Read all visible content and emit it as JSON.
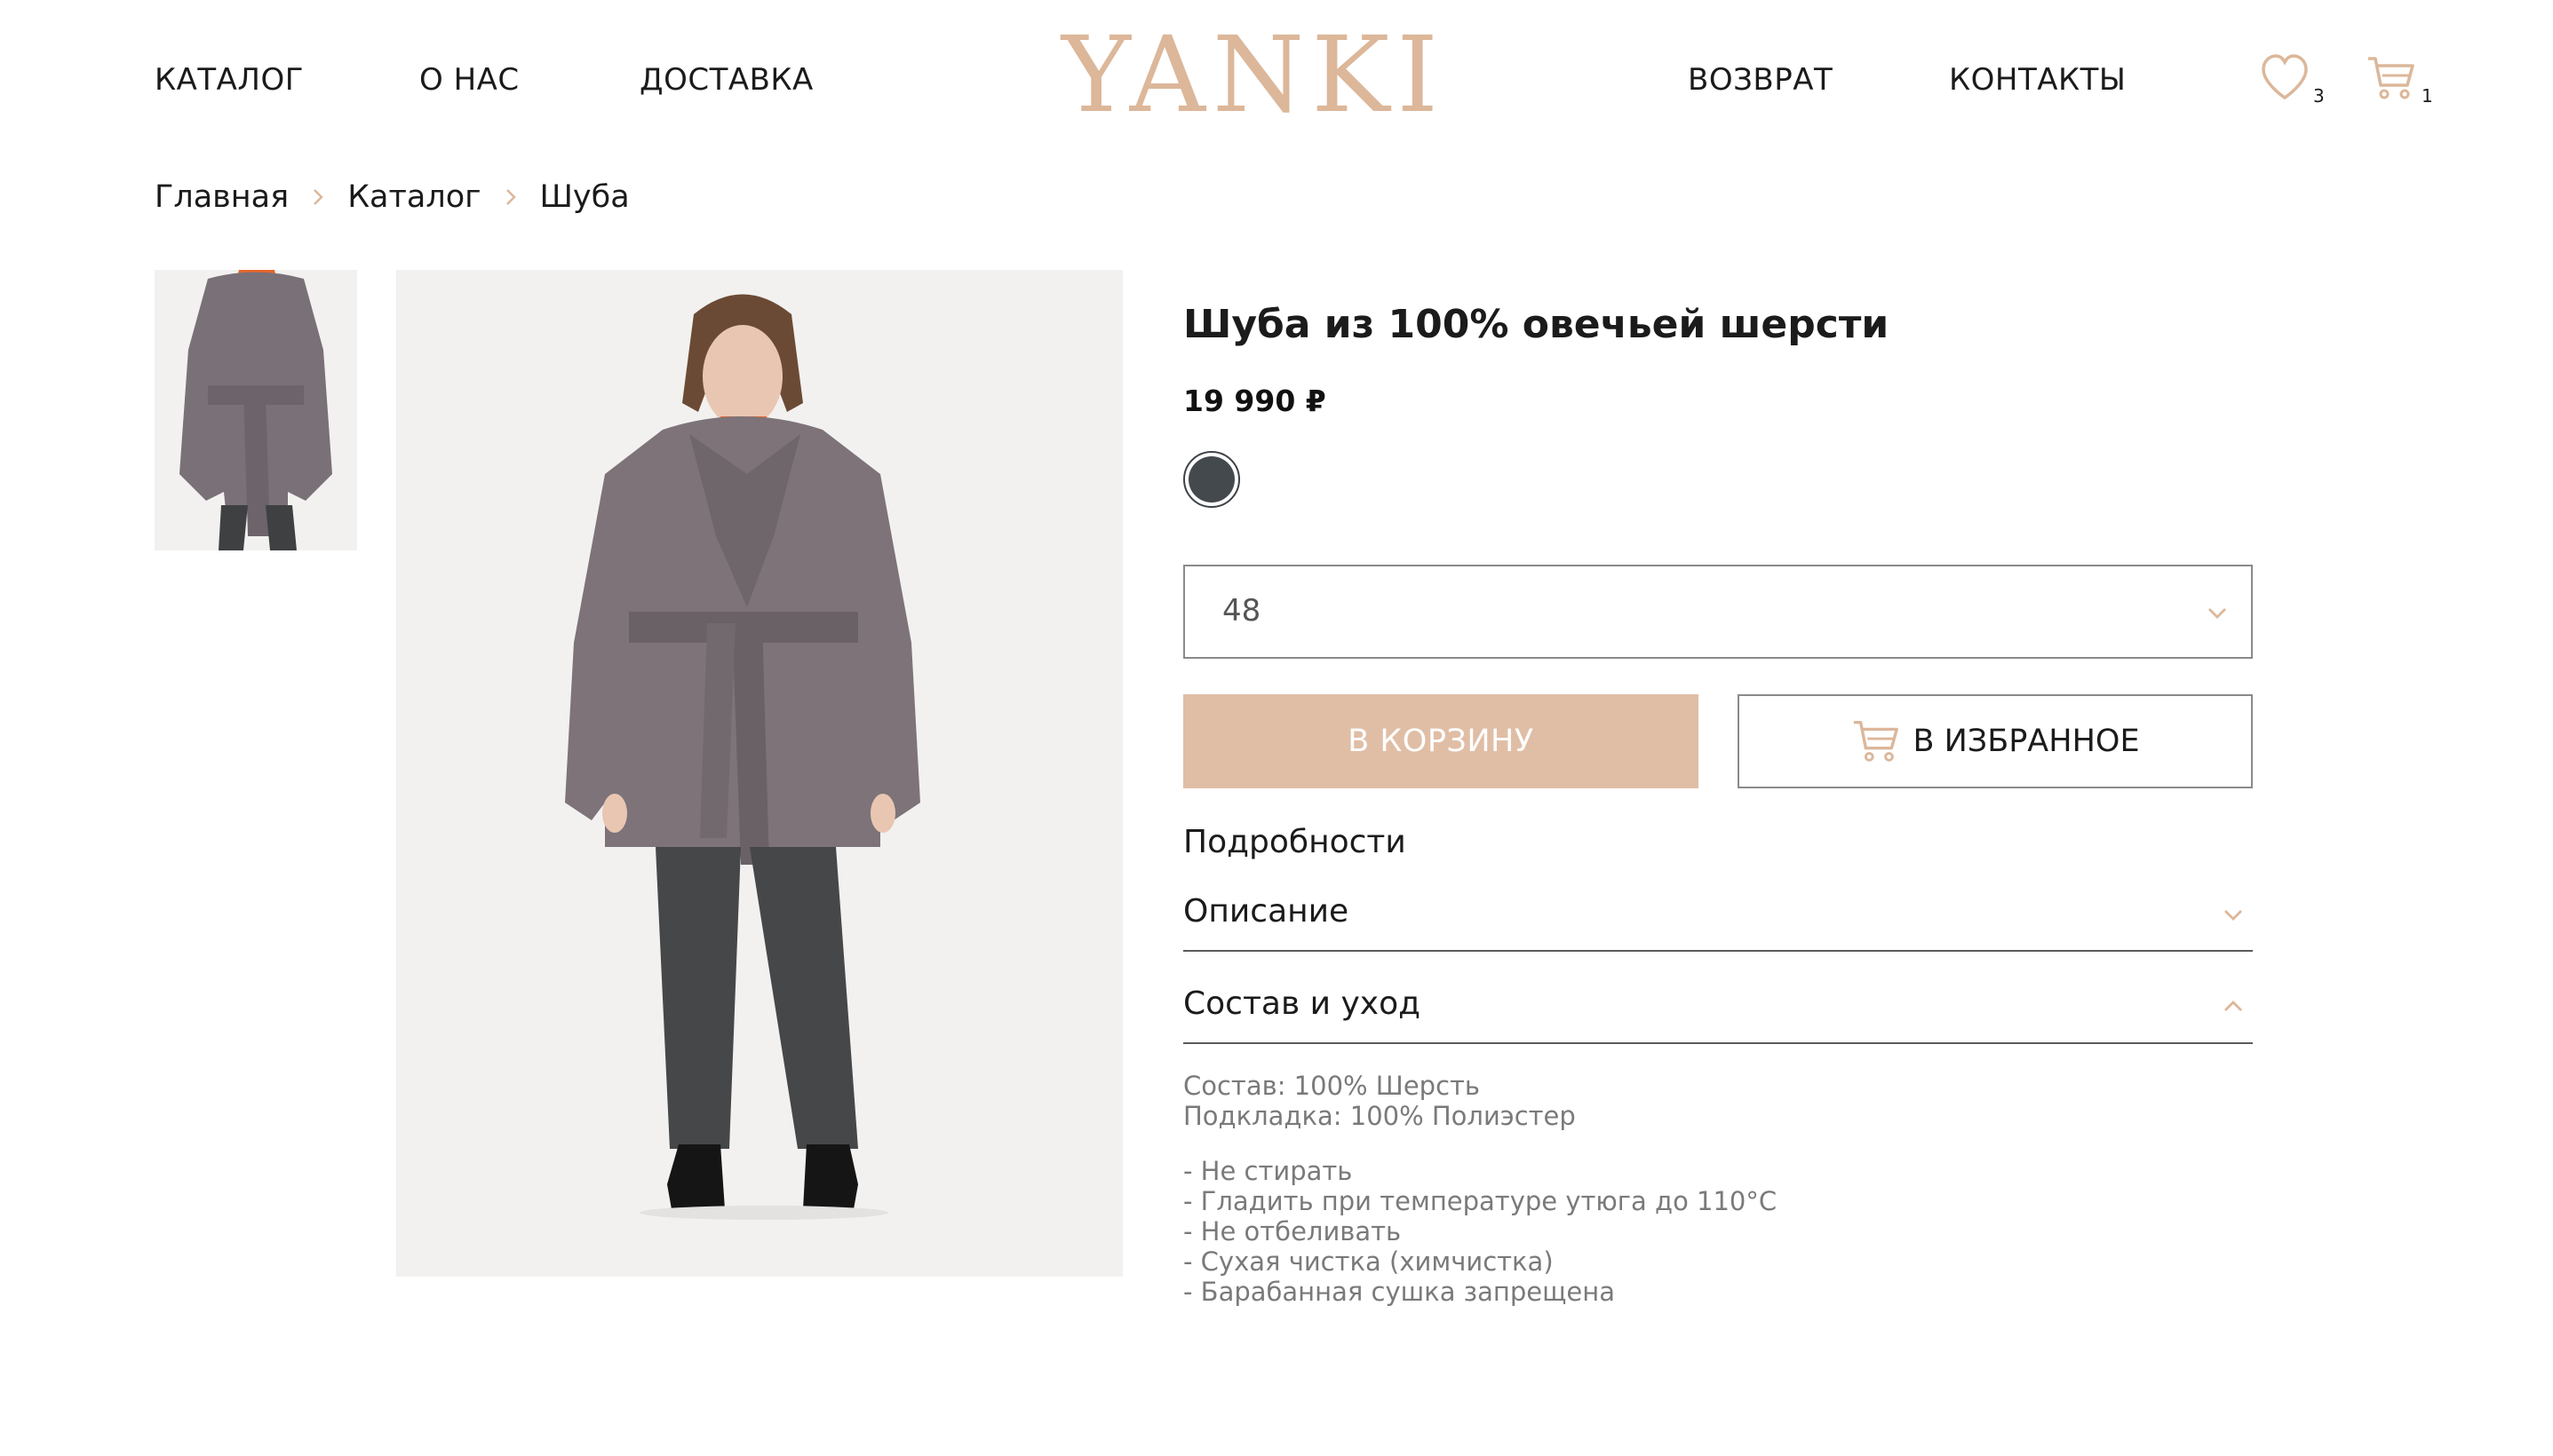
{
  "brand": {
    "logo": "YANKI",
    "accent": "#dcb79a"
  },
  "nav": {
    "left": [
      "КАТАЛОГ",
      "О НАС",
      "ДОСТАВКА"
    ],
    "right": [
      "ВОЗВРАТ",
      "КОНТАКТЫ"
    ]
  },
  "header_icons": {
    "favorites": {
      "icon": "heart-icon",
      "count": "3"
    },
    "cart": {
      "icon": "cart-icon",
      "count": "1"
    }
  },
  "breadcrumb": [
    "Главная",
    "Каталог",
    "Шуба"
  ],
  "product": {
    "title": "Шуба из 100% овечьей шерсти",
    "price": "19 990 ₽",
    "color_swatch": "#44494e",
    "size_selected": "48",
    "add_to_cart_label": "В КОРЗИНУ",
    "add_to_favorites_label": "В ИЗБРАННОЕ",
    "cart_button_color": "#e0bea6"
  },
  "details": {
    "label": "Подробности",
    "sections": [
      {
        "title": "Описание",
        "expanded": false
      },
      {
        "title": "Состав и уход",
        "expanded": true
      }
    ],
    "composition": [
      "Состав: 100% Шерсть",
      "Подкладка: 100% Полиэстер"
    ],
    "care": [
      "- Не стирать",
      "- Гладить при температуре утюга до 110°С",
      "- Не отбеливать",
      "- Сухая чистка (химчистка)",
      "- Барабанная сушка запрещена"
    ]
  }
}
